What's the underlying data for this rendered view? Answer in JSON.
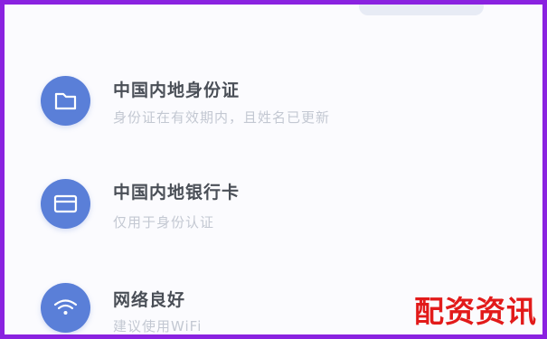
{
  "items": [
    {
      "icon": "folder-icon",
      "title": "中国内地身份证",
      "description": "身份证在有效期内，且姓名已更新"
    },
    {
      "icon": "bank-card-icon",
      "title": "中国内地银行卡",
      "description": "仅用于身份认证"
    },
    {
      "icon": "wifi-icon",
      "title": "网络良好",
      "description": "建议使用WiFi"
    }
  ],
  "watermark": "配资资讯",
  "colors": {
    "accent": "#5a7fd8",
    "border": "#8a22e0",
    "watermark": "#e21a1a"
  }
}
